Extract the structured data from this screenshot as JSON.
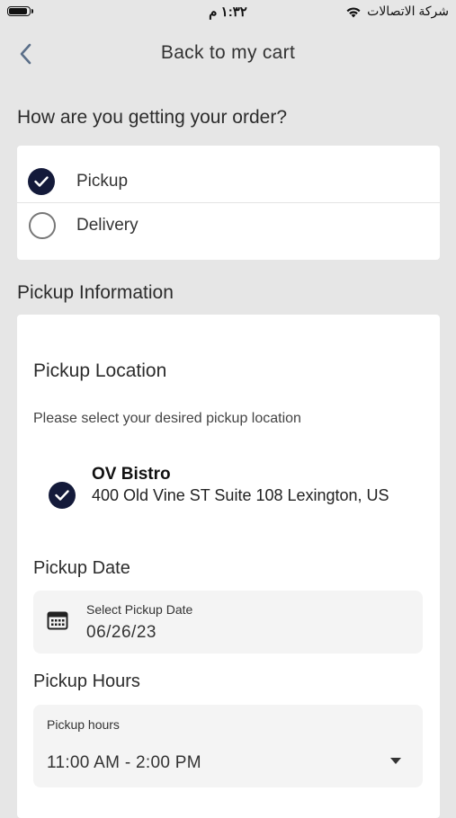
{
  "status_bar": {
    "time": "١:٣٢ م",
    "carrier": "شركة الاتصالات"
  },
  "nav": {
    "title": "Back to my cart"
  },
  "order_method": {
    "heading": "How are you getting your order?",
    "options": [
      {
        "label": "Pickup",
        "selected": true
      },
      {
        "label": "Delivery",
        "selected": false
      }
    ]
  },
  "pickup_info": {
    "heading": "Pickup Information",
    "location": {
      "title": "Pickup Location",
      "helper": "Please select your desired pickup location",
      "name": "OV Bistro",
      "address": "400 Old Vine ST Suite 108 Lexington, US",
      "selected": true
    },
    "date": {
      "title": "Pickup Date",
      "label": "Select Pickup Date",
      "value": "06/26/23"
    },
    "hours": {
      "title": "Pickup Hours",
      "label": "Pickup hours",
      "value": "11:00 AM - 2:00 PM"
    }
  },
  "colors": {
    "background": "#e6e6e6",
    "accent": "#141a3a",
    "card": "#ffffff",
    "field": "#f4f4f4"
  },
  "icons": [
    "battery-icon",
    "wifi-icon",
    "back-chevron-icon",
    "check-circle-icon",
    "radio-empty-icon",
    "calendar-icon",
    "dropdown-arrow-icon"
  ]
}
